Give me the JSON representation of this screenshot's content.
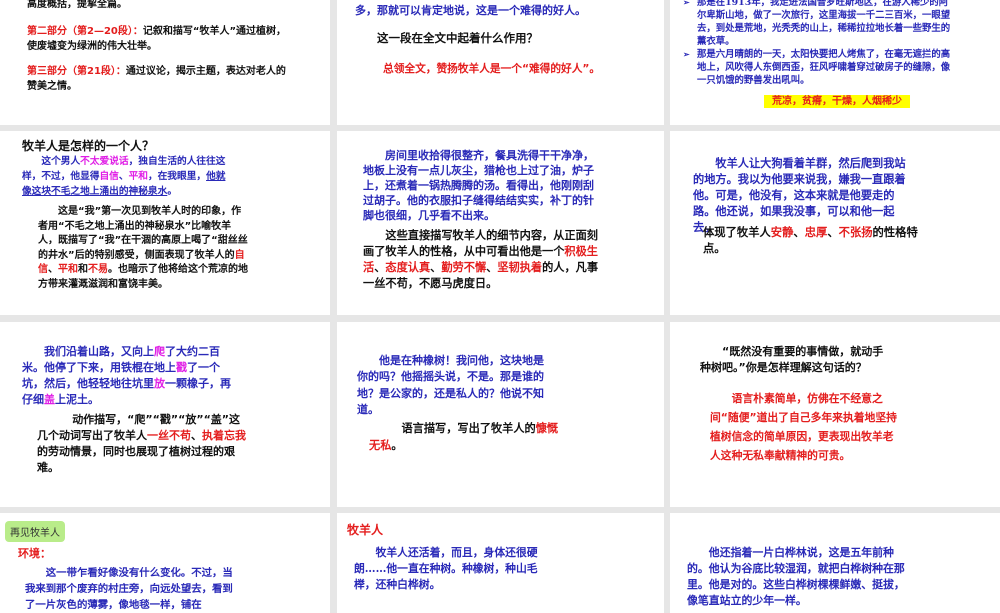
{
  "colors": {
    "blue": "#2a2ab8",
    "red": "#e41e1e",
    "magenta": "#e01ee6",
    "black": "#111111",
    "highlight": "#ffff00",
    "tag": "#b9ec8a",
    "background": "#e6e6e6"
  },
  "slides": [
    {
      "paras": [
        [
          {
            "t": "高度概括，提挈全篇。",
            "c": "k"
          }
        ],
        [
          {
            "t": "第二部分（第2—20段）：",
            "c": "r"
          },
          {
            "t": "记叙和描写“牧羊人”通过植树，使废墟变为绿洲的伟大壮举。",
            "c": "k"
          }
        ],
        [
          {
            "t": "第三部分（第21段）：",
            "c": "r"
          },
          {
            "t": "通过议论，揭示主题，表达对老人的赞美之情。",
            "c": "k"
          }
        ]
      ]
    },
    {
      "paras": [
        [
          {
            "t": "多，那就可以肯定地说，这是一个难得的好人。",
            "c": "b"
          }
        ],
        [
          {
            "t": "这一段在全文中起着什么作用？",
            "c": "k"
          }
        ],
        [
          {
            "t": "总领全文，赞扬牧羊人是一个“难得的好人”。",
            "c": "r"
          }
        ]
      ]
    },
    {
      "paras": [
        [
          {
            "t": "那是在1913年，我走进法国普罗旺斯地区，在游人稀少的阿尔卑斯山地，做了一次旅行，这里海拔一千二三百米，一眼望去，到处是荒地，光秃秃的山上，稀稀拉拉地长着一些野生的薰衣草。",
            "c": "b"
          }
        ],
        [
          {
            "t": "那是六月晴朗的一天，太阳快要把人烤焦了，在毫无遮拦的高地上，风吹得人东倒西歪，狂风呼啸着穿过破房子的缝隙，像一只饥饿的野兽发出吼叫。",
            "c": "b"
          }
        ],
        [
          {
            "t": "荒凉，贫瘠，干燥，人烟稀少",
            "c": "r"
          }
        ]
      ]
    },
    {
      "paras": [
        [
          {
            "t": "牧羊人是怎样的一个人？",
            "c": "k"
          }
        ],
        [
          {
            "t": "这个男人",
            "c": "b"
          },
          {
            "t": "不太爱说话",
            "c": "m"
          },
          {
            "t": "，独自生活的人往往这样，不过，他显得",
            "c": "b"
          },
          {
            "t": "自信",
            "c": "m"
          },
          {
            "t": "、",
            "c": "b"
          },
          {
            "t": "平和",
            "c": "m"
          },
          {
            "t": "，在我眼里，",
            "c": "b"
          },
          {
            "t": "他就像这块不毛之地上涌出的神秘泉水",
            "c": "b",
            "u": true
          },
          {
            "t": "。",
            "c": "b"
          }
        ],
        [
          {
            "t": "这是“我”第一次见到牧羊人时的印象，作者用“不毛之地上涌出的神秘泉水”比喻牧羊人，既描写了“我”在干涸的高原上喝了“甜丝丝的井水”后的特别感受，侧面表现了牧羊人的",
            "c": "k"
          },
          {
            "t": "自信",
            "c": "r"
          },
          {
            "t": "、",
            "c": "k"
          },
          {
            "t": "平和",
            "c": "r"
          },
          {
            "t": "和",
            "c": "k"
          },
          {
            "t": "不易",
            "c": "r"
          },
          {
            "t": "。也暗示了他将给这个荒凉的地方带来灌溉滋润和富饶丰美。",
            "c": "k"
          }
        ]
      ]
    },
    {
      "paras": [
        [
          {
            "t": "房间里收拾得很整齐，餐具洗得干干净净，地板上没有一点儿灰尘，猎枪也上过了油，炉子上，还煮着一锅热腾腾的汤。看得出，他刚刚刮过胡子。他的衣服扣子缝得结结实实，补丁的针脚也很细，几乎看不出来。",
            "c": "b"
          }
        ],
        [
          {
            "t": "这些直接描写牧羊人的细节内容，从正面刻画了牧羊人的性格，从中可看出他是一个",
            "c": "k"
          },
          {
            "t": "积极生活",
            "c": "r"
          },
          {
            "t": "、",
            "c": "k"
          },
          {
            "t": "态度认真",
            "c": "r"
          },
          {
            "t": "、",
            "c": "k"
          },
          {
            "t": "勤劳不懈",
            "c": "r"
          },
          {
            "t": "、",
            "c": "k"
          },
          {
            "t": "坚韧执着",
            "c": "r"
          },
          {
            "t": "的人，凡事一丝不苟，不愿马虎度日。",
            "c": "k"
          }
        ]
      ]
    },
    {
      "paras": [
        [
          {
            "t": "牧羊人让大狗看着羊群，然后爬到我站的地方。我以为他要来说我，嫌我一直跟着他。可是，他没有，这本来就是他要走的路。他还说，如果我没事，可以和他一起去。",
            "c": "b"
          }
        ],
        [
          {
            "t": "体现了牧羊人",
            "c": "k"
          },
          {
            "t": "安静",
            "c": "r"
          },
          {
            "t": "、",
            "c": "k"
          },
          {
            "t": "忠厚",
            "c": "r"
          },
          {
            "t": "、",
            "c": "k"
          },
          {
            "t": "不张扬",
            "c": "r"
          },
          {
            "t": "的性格特点。",
            "c": "k"
          }
        ]
      ]
    },
    {
      "paras": [
        [
          {
            "t": "我们沿着山路，又向上",
            "c": "b"
          },
          {
            "t": "爬",
            "c": "m"
          },
          {
            "t": "了大约二百米。他停了下来，用铁棍在地上",
            "c": "b"
          },
          {
            "t": "戳",
            "c": "m"
          },
          {
            "t": "了一个坑，然后，他轻轻地往坑里",
            "c": "b"
          },
          {
            "t": "放",
            "c": "m"
          },
          {
            "t": "一颗橡子，再仔细",
            "c": "b"
          },
          {
            "t": "盖",
            "c": "m"
          },
          {
            "t": "上泥土。",
            "c": "b"
          }
        ],
        [
          {
            "t": "动作描写，“爬”“戳”“放”“盖”这几个动词写出了牧羊人",
            "c": "k"
          },
          {
            "t": "一丝不苟",
            "c": "r"
          },
          {
            "t": "、",
            "c": "k"
          },
          {
            "t": "执着忘我",
            "c": "r"
          },
          {
            "t": "的劳动情景，同时也展现了植树过程的艰难。",
            "c": "k"
          }
        ]
      ]
    },
    {
      "paras": [
        [
          {
            "t": "他是在种橡树！我问他，这块地是你的吗？他摇摇头说，不是。那是谁的地？是公家的，还是私人的？他说不知道。",
            "c": "b"
          }
        ],
        [
          {
            "t": "语言描写，写出了牧羊人的",
            "c": "k"
          },
          {
            "t": "慷慨无私",
            "c": "r"
          },
          {
            "t": "。",
            "c": "k"
          }
        ]
      ]
    },
    {
      "paras": [
        [
          {
            "t": "“既然没有重要的事情做，就动手种树吧。”你是怎样理解这句话的？",
            "c": "k"
          }
        ],
        [
          {
            "t": "语言朴素简单，仿佛在不经意之间“随便”道出了自己多年来执着地坚持植树信念的简单原因，更表现出牧羊老人这种无私奉献精神的可贵。",
            "c": "r"
          }
        ]
      ]
    },
    {
      "tag": "再见牧羊人",
      "paras": [
        [
          {
            "t": "环境：",
            "c": "r"
          }
        ],
        [
          {
            "t": "这一带乍看好像没有什么变化。不过，当我来到那个废弃的村庄旁，向远处望去，看到了一片灰色的薄雾，像地毯一样，铺在",
            "c": "b"
          }
        ]
      ]
    },
    {
      "paras": [
        [
          {
            "t": "牧羊人",
            "c": "r"
          }
        ],
        [
          {
            "t": "牧羊人还活着，而且，身体还很硬朗……他一直在种树。种橡树，种山毛榉，还种白桦树。",
            "c": "b"
          }
        ]
      ]
    },
    {
      "paras": [
        [
          {
            "t": "他还指着一片白桦林说，这是五年前种的。他认为谷底比较湿润，就把白桦树种在那里。他是对的。这些白桦树棵棵鲜嫩、挺拔，像笔直站立的少年一样。",
            "c": "b"
          }
        ]
      ]
    }
  ]
}
